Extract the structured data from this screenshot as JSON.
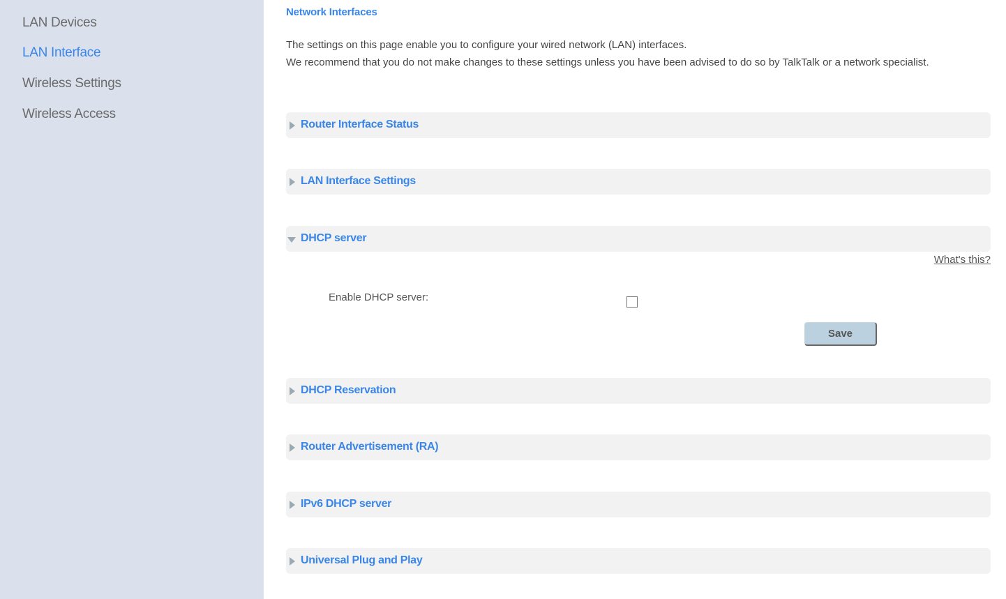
{
  "sidebar": {
    "items": [
      {
        "label": "LAN Devices",
        "active": false
      },
      {
        "label": "LAN Interface",
        "active": true
      },
      {
        "label": "Wireless Settings",
        "active": false
      },
      {
        "label": "Wireless Access",
        "active": false
      }
    ]
  },
  "main": {
    "title": "Network Interfaces",
    "intro_line1": "The settings on this page enable you to configure your wired network (LAN) interfaces.",
    "intro_line2": "We recommend that you do not make changes to these settings unless you have been advised to do so by TalkTalk or a network specialist.",
    "sections": [
      {
        "label": "Router Interface Status",
        "expanded": false
      },
      {
        "label": "LAN Interface Settings",
        "expanded": false
      },
      {
        "label": "DHCP server",
        "expanded": true
      },
      {
        "label": "DHCP Reservation",
        "expanded": false
      },
      {
        "label": "Router Advertisement (RA)",
        "expanded": false
      },
      {
        "label": "IPv6 DHCP server",
        "expanded": false
      },
      {
        "label": "Universal Plug and Play",
        "expanded": false
      }
    ],
    "dhcp": {
      "whats_this": "What's this?",
      "enable_label": "Enable DHCP server:",
      "enabled": false,
      "save_label": "Save"
    }
  }
}
